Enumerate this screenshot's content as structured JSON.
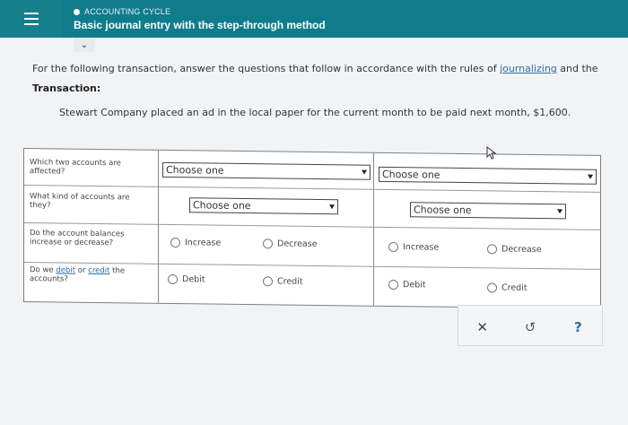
{
  "header": {
    "breadcrumb": "ACCOUNTING CYCLE",
    "title": "Basic journal entry with the step-through method",
    "collapse_glyph": "⌄"
  },
  "instructions": {
    "prefix": "For the following transaction, answer the questions that follow in accordance with the rules of ",
    "link": "journalizing",
    "suffix": " and the"
  },
  "transaction": {
    "label": "Transaction:",
    "text": "Stewart Company placed an ad in the local paper for the current month to be paid next month, $1,600."
  },
  "table": {
    "rows": [
      {
        "label": "Which two accounts are affected?"
      },
      {
        "label": "What kind of accounts are they?"
      },
      {
        "label": "Do the account balances increase or decrease?"
      },
      {
        "label_prefix": "Do we ",
        "debit_link": "debit",
        "mid": " or ",
        "credit_link": "credit",
        "suffix": " the accounts?"
      }
    ],
    "select_placeholder": "Choose one",
    "radio_increase": "Increase",
    "radio_decrease": "Decrease",
    "radio_debit": "Debit",
    "radio_credit": "Credit"
  },
  "actions": {
    "clear": "✕",
    "undo": "↺",
    "help": "?"
  },
  "colors": {
    "header_bg": "#0f7c8c",
    "link": "#2a6fa8"
  }
}
